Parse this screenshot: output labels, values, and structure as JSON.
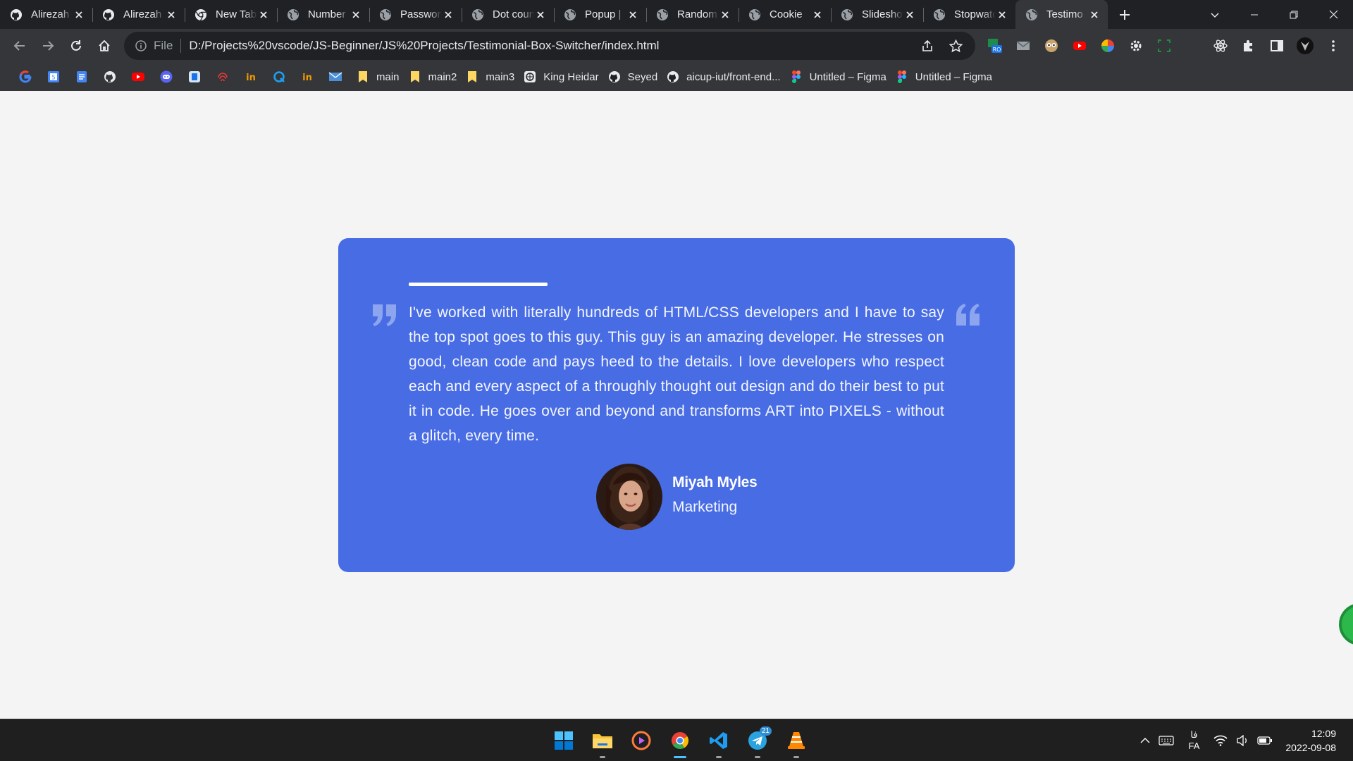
{
  "browser": {
    "tabs": [
      {
        "title": "Alirezah",
        "icon": "github-icon",
        "active": false
      },
      {
        "title": "Alirezah",
        "icon": "github-icon",
        "active": false
      },
      {
        "title": "New Tab",
        "icon": "chrome-icon",
        "active": false
      },
      {
        "title": "Number",
        "icon": "globe-icon",
        "active": false
      },
      {
        "title": "Password",
        "icon": "globe-icon",
        "active": false
      },
      {
        "title": "Dot count",
        "icon": "globe-icon",
        "active": false
      },
      {
        "title": "Popup |",
        "icon": "globe-icon",
        "active": false
      },
      {
        "title": "Random",
        "icon": "globe-icon",
        "active": false
      },
      {
        "title": "Cookie",
        "icon": "globe-icon",
        "active": false
      },
      {
        "title": "Slideshow",
        "icon": "globe-icon",
        "active": false
      },
      {
        "title": "Stopwatch",
        "icon": "globe-icon",
        "active": false
      },
      {
        "title": "Testimo",
        "icon": "globe-icon",
        "active": true
      }
    ],
    "omnibox": {
      "scheme": "File",
      "url": "D:/Projects%20vscode/JS-Beginner/JS%20Projects/Testimonial-Box-Switcher/index.html"
    },
    "bookmarks": {
      "icon_only": [
        "google-icon",
        "google-calendar-icon",
        "google-docs-icon",
        "github-icon",
        "youtube-icon",
        "discord-icon",
        "app-icon",
        "fingerprint-icon",
        "in-icon",
        "q-icon",
        "in-icon",
        "mail-icon"
      ],
      "items": [
        {
          "label": "main",
          "icon": "folder-icon"
        },
        {
          "label": "main2",
          "icon": "folder-icon"
        },
        {
          "label": "main3",
          "icon": "folder-icon"
        },
        {
          "label": "King Heidar",
          "icon": "site-icon"
        },
        {
          "label": "Seyed",
          "icon": "github-icon"
        },
        {
          "label": "aicup-iut/front-end...",
          "icon": "github-icon"
        },
        {
          "label": "Untitled – Figma",
          "icon": "figma-icon"
        },
        {
          "label": "Untitled – Figma",
          "icon": "figma-icon"
        }
      ]
    }
  },
  "testimonial": {
    "text": "I've worked with literally hundreds of HTML/CSS developers and I have to say the top spot goes to this guy. This guy is an amazing developer. He stresses on good, clean code and pays heed to the details. I love developers who respect each and every aspect of a throughly thought out design and do their best to put it in code. He goes over and beyond and transforms ART into PIXELS - without a glitch, every time.",
    "name": "Miyah Myles",
    "role": "Marketing",
    "card_color": "#476ce4"
  },
  "taskbar": {
    "apps": [
      "windows-start-icon",
      "file-explorer-icon",
      "media-player-icon",
      "chrome-icon",
      "vscode-icon",
      "telegram-icon",
      "vlc-icon"
    ],
    "telegram_badge": "21",
    "language_top": "فا",
    "language": "FA",
    "time": "12:09",
    "date": "2022-09-08"
  }
}
